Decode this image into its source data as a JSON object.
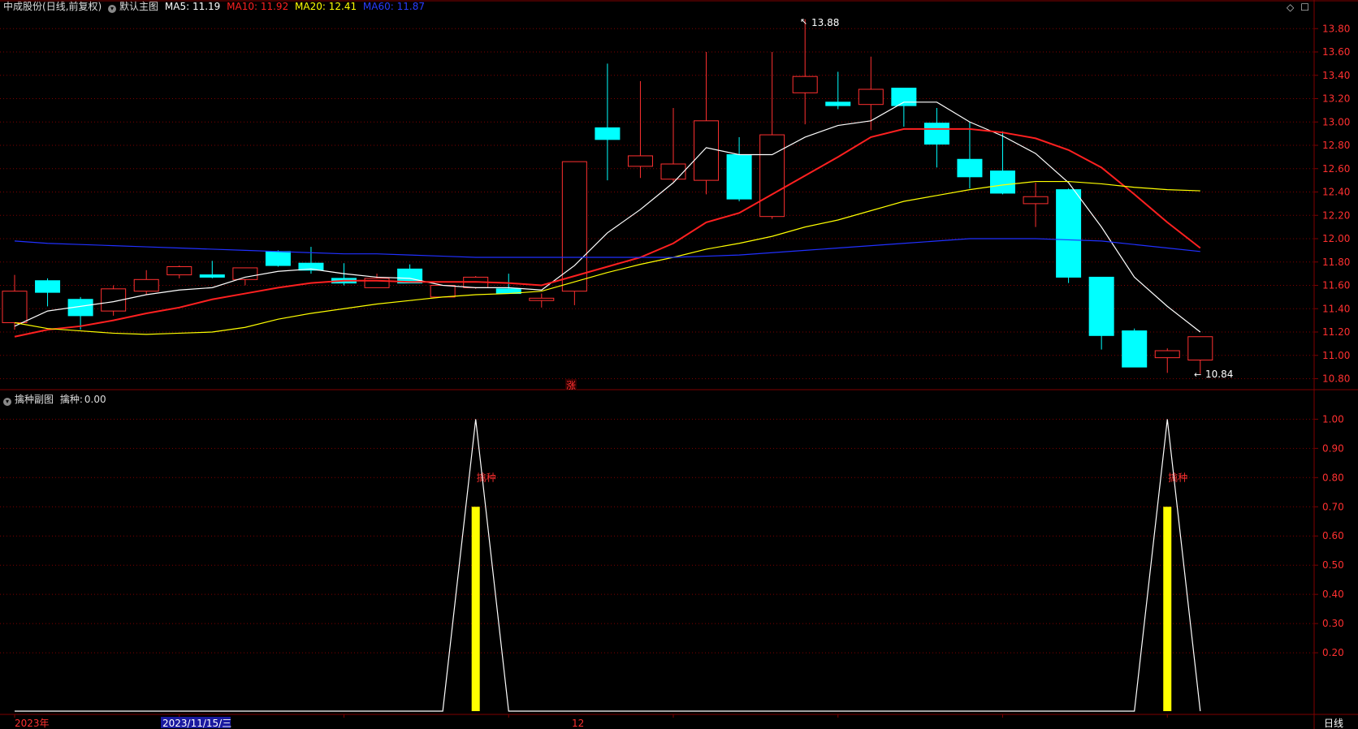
{
  "main_header": {
    "title": "中成股份",
    "period": "(日线,前复权)",
    "chart_name": "默认主图",
    "ma5": {
      "label": "MA5:",
      "value": "11.19",
      "color": "#ffffff"
    },
    "ma10": {
      "label": "MA10:",
      "value": "11.92",
      "color": "#ff2020"
    },
    "ma20": {
      "label": "MA20:",
      "value": "12.41",
      "color": "#ffff00"
    },
    "ma60": {
      "label": "MA60:",
      "value": "11.87",
      "color": "#2030ff"
    }
  },
  "sub_header": {
    "chart_name": "擒种副图",
    "label": "擒种:",
    "value": "0.00"
  },
  "top_right_icons": [
    "diamond-icon",
    "square-icon"
  ],
  "annotations": {
    "high": "13.88",
    "low": "10.84",
    "zhang_marker": "涨",
    "signal_label": "擒种"
  },
  "x_axis": {
    "year_label": "2023年",
    "cursor_date": "2023/11/15/三",
    "month_label": "12",
    "period_button": "日线"
  },
  "colors": {
    "up": "#ff3030",
    "down": "#00ffff",
    "grid": "#800000",
    "axis_text": "#ff3030",
    "signal_bar": "#ffff00"
  },
  "chart_data": [
    {
      "type": "candlestick",
      "title": "中成股份 (日线,前复权)",
      "ylim": [
        10.72,
        13.92
      ],
      "yticks": [
        "13.80",
        "13.60",
        "13.40",
        "13.20",
        "13.00",
        "12.80",
        "12.60",
        "12.40",
        "12.20",
        "12.00",
        "11.80",
        "11.60",
        "11.40",
        "11.20",
        "11.00",
        "10.80"
      ],
      "candles": [
        {
          "o": 11.28,
          "c": 11.55,
          "h": 11.69,
          "l": 11.22
        },
        {
          "o": 11.64,
          "c": 11.54,
          "h": 11.66,
          "l": 11.42
        },
        {
          "o": 11.48,
          "c": 11.34,
          "h": 11.5,
          "l": 11.22
        },
        {
          "o": 11.38,
          "c": 11.57,
          "h": 11.6,
          "l": 11.34
        },
        {
          "o": 11.55,
          "c": 11.65,
          "h": 11.73,
          "l": 11.52
        },
        {
          "o": 11.69,
          "c": 11.76,
          "h": 11.77,
          "l": 11.66
        },
        {
          "o": 11.69,
          "c": 11.67,
          "h": 11.81,
          "l": 11.66
        },
        {
          "o": 11.65,
          "c": 11.75,
          "h": 11.75,
          "l": 11.6
        },
        {
          "o": 11.89,
          "c": 11.77,
          "h": 11.9,
          "l": 11.76
        },
        {
          "o": 11.79,
          "c": 11.73,
          "h": 11.93,
          "l": 11.7
        },
        {
          "o": 11.66,
          "c": 11.62,
          "h": 11.79,
          "l": 11.6
        },
        {
          "o": 11.58,
          "c": 11.66,
          "h": 11.7,
          "l": 11.58
        },
        {
          "o": 11.74,
          "c": 11.62,
          "h": 11.78,
          "l": 11.62
        },
        {
          "o": 11.5,
          "c": 11.6,
          "h": 11.6,
          "l": 11.5
        },
        {
          "o": 11.58,
          "c": 11.67,
          "h": 11.68,
          "l": 11.57
        },
        {
          "o": 11.57,
          "c": 11.53,
          "h": 11.7,
          "l": 11.53
        },
        {
          "o": 11.47,
          "c": 11.49,
          "h": 11.53,
          "l": 11.41
        },
        {
          "o": 11.55,
          "c": 12.66,
          "h": 12.66,
          "l": 11.43
        },
        {
          "o": 12.95,
          "c": 12.85,
          "h": 13.5,
          "l": 12.5
        },
        {
          "o": 12.62,
          "c": 12.71,
          "h": 13.35,
          "l": 12.52
        },
        {
          "o": 12.51,
          "c": 12.64,
          "h": 13.12,
          "l": 12.49
        },
        {
          "o": 12.5,
          "c": 13.01,
          "h": 13.6,
          "l": 12.38
        },
        {
          "o": 12.72,
          "c": 12.34,
          "h": 12.87,
          "l": 12.32
        },
        {
          "o": 12.19,
          "c": 12.89,
          "h": 13.6,
          "l": 12.17
        },
        {
          "o": 13.25,
          "c": 13.39,
          "h": 13.88,
          "l": 12.98
        },
        {
          "o": 13.17,
          "c": 13.14,
          "h": 13.43,
          "l": 13.11
        },
        {
          "o": 13.15,
          "c": 13.28,
          "h": 13.56,
          "l": 12.93
        },
        {
          "o": 13.29,
          "c": 13.14,
          "h": 13.29,
          "l": 12.96
        },
        {
          "o": 12.99,
          "c": 12.81,
          "h": 13.12,
          "l": 12.61
        },
        {
          "o": 12.68,
          "c": 12.53,
          "h": 13.0,
          "l": 12.43
        },
        {
          "o": 12.58,
          "c": 12.39,
          "h": 12.92,
          "l": 12.38
        },
        {
          "o": 12.3,
          "c": 12.36,
          "h": 12.48,
          "l": 12.1
        },
        {
          "o": 12.42,
          "c": 11.67,
          "h": 12.43,
          "l": 11.62
        },
        {
          "o": 11.67,
          "c": 11.17,
          "h": 11.67,
          "l": 11.05
        },
        {
          "o": 11.21,
          "c": 10.9,
          "h": 11.23,
          "l": 10.9
        },
        {
          "o": 10.98,
          "c": 11.04,
          "h": 11.06,
          "l": 10.85
        },
        {
          "o": 10.96,
          "c": 11.16,
          "h": 11.16,
          "l": 10.84
        }
      ],
      "series": [
        {
          "name": "MA5",
          "color": "#ffffff",
          "values": [
            11.25,
            11.38,
            11.42,
            11.46,
            11.52,
            11.56,
            11.58,
            11.67,
            11.72,
            11.74,
            11.7,
            11.67,
            11.66,
            11.6,
            11.58,
            11.58,
            11.56,
            11.77,
            12.05,
            12.25,
            12.48,
            12.78,
            12.72,
            12.72,
            12.87,
            12.97,
            13.01,
            13.17,
            13.17,
            13.0,
            12.88,
            12.73,
            12.48,
            12.1,
            11.67,
            11.42,
            11.2
          ]
        },
        {
          "name": "MA10",
          "color": "#ff2020",
          "values": [
            11.16,
            11.22,
            11.25,
            11.3,
            11.36,
            11.41,
            11.48,
            11.53,
            11.58,
            11.62,
            11.64,
            11.64,
            11.63,
            11.63,
            11.63,
            11.62,
            11.6,
            11.68,
            11.76,
            11.84,
            11.96,
            12.14,
            12.22,
            12.38,
            12.54,
            12.7,
            12.87,
            12.94,
            12.94,
            12.94,
            12.91,
            12.86,
            12.76,
            12.61,
            12.38,
            12.14,
            11.92
          ]
        },
        {
          "name": "MA20",
          "color": "#ffff00",
          "values": [
            11.28,
            11.23,
            11.21,
            11.19,
            11.18,
            11.19,
            11.2,
            11.24,
            11.31,
            11.36,
            11.4,
            11.44,
            11.47,
            11.5,
            11.52,
            11.53,
            11.55,
            11.63,
            11.71,
            11.78,
            11.84,
            11.91,
            11.96,
            12.02,
            12.1,
            12.16,
            12.24,
            12.32,
            12.37,
            12.42,
            12.46,
            12.49,
            12.49,
            12.47,
            12.44,
            12.42,
            12.41
          ]
        },
        {
          "name": "MA60",
          "color": "#2030ff",
          "values": [
            11.98,
            11.96,
            11.95,
            11.94,
            11.93,
            11.92,
            11.91,
            11.9,
            11.89,
            11.88,
            11.87,
            11.87,
            11.86,
            11.85,
            11.84,
            11.84,
            11.84,
            11.84,
            11.84,
            11.84,
            11.84,
            11.85,
            11.86,
            11.88,
            11.9,
            11.92,
            11.94,
            11.96,
            11.98,
            12.0,
            12.0,
            12.0,
            11.99,
            11.98,
            11.95,
            11.92,
            11.89
          ]
        }
      ]
    },
    {
      "type": "line",
      "title": "擒种副图",
      "ylim": [
        0,
        1.04
      ],
      "yticks": [
        "1.00",
        "0.90",
        "0.80",
        "0.70",
        "0.60",
        "0.50",
        "0.40",
        "0.30",
        "0.20"
      ],
      "series": [
        {
          "name": "擒种",
          "color": "#ffffff",
          "values": [
            0,
            0,
            0,
            0,
            0,
            0,
            0,
            0,
            0,
            0,
            0,
            0,
            0,
            0,
            1,
            0,
            0,
            0,
            0,
            0,
            0,
            0,
            0,
            0,
            0,
            0,
            0,
            0,
            0,
            0,
            0,
            0,
            0,
            0,
            0,
            1,
            0
          ]
        }
      ],
      "signal_bars": [
        {
          "index": 14,
          "value": 0.7
        },
        {
          "index": 35,
          "value": 0.7
        }
      ]
    }
  ]
}
